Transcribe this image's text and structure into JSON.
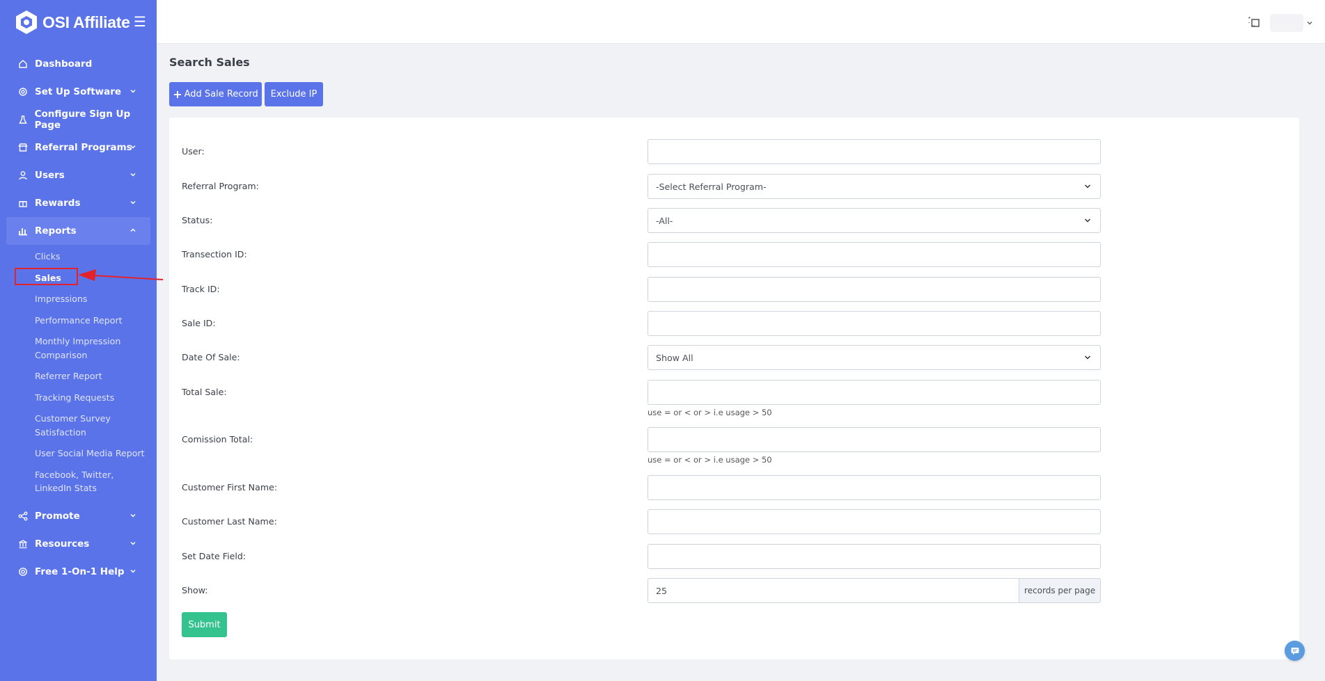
{
  "brand": {
    "name": "OSI Affiliate"
  },
  "sidebar": {
    "items": [
      {
        "label": "Dashboard",
        "icon": "home-icon",
        "has_chevron": false
      },
      {
        "label": "Set Up Software",
        "icon": "gear-icon",
        "has_chevron": true
      },
      {
        "label": "Configure Sign Up Page",
        "icon": "flask-icon",
        "has_chevron": false
      },
      {
        "label": "Referral Programs",
        "icon": "store-icon",
        "has_chevron": true
      },
      {
        "label": "Users",
        "icon": "user-icon",
        "has_chevron": true
      },
      {
        "label": "Rewards",
        "icon": "gift-icon",
        "has_chevron": true
      },
      {
        "label": "Reports",
        "icon": "bar-chart-icon",
        "has_chevron": true,
        "active": true
      }
    ],
    "reports_submenu": [
      "Clicks",
      "Sales",
      "Impressions",
      "Performance Report",
      "Monthly Impression Comparison",
      "Referrer Report",
      "Tracking Requests",
      "Customer Survey Satisfaction",
      "User Social Media Report",
      "Facebook, Twitter, LinkedIn Stats"
    ],
    "current_submenu": "Sales",
    "bottom_items": [
      {
        "label": "Promote",
        "icon": "share-icon",
        "has_chevron": true
      },
      {
        "label": "Resources",
        "icon": "bank-icon",
        "has_chevron": true
      },
      {
        "label": "Free 1-On-1 Help",
        "icon": "lifebuoy-icon",
        "has_chevron": true
      }
    ]
  },
  "page": {
    "title": "Search Sales",
    "add_button": "Add Sale Record",
    "exclude_button": "Exclude IP"
  },
  "form": {
    "fields": [
      {
        "label": "User:",
        "type": "text",
        "value": ""
      },
      {
        "label": "Referral Program:",
        "type": "select",
        "value": "-Select Referral Program-"
      },
      {
        "label": "Status:",
        "type": "select",
        "value": "-All-"
      },
      {
        "label": "Transection ID:",
        "type": "text",
        "value": ""
      },
      {
        "label": "Track ID:",
        "type": "text",
        "value": ""
      },
      {
        "label": "Sale ID:",
        "type": "text",
        "value": ""
      },
      {
        "label": "Date Of Sale:",
        "type": "select",
        "value": "Show All"
      },
      {
        "label": "Total Sale:",
        "type": "text",
        "value": "",
        "hint": "use = or < or > i.e usage > 50"
      },
      {
        "label": "Comission Total:",
        "type": "text",
        "value": "",
        "hint": "use = or < or > i.e usage > 50"
      },
      {
        "label": "Customer First Name:",
        "type": "text",
        "value": ""
      },
      {
        "label": "Customer Last Name:",
        "type": "text",
        "value": ""
      },
      {
        "label": "Set Date Field:",
        "type": "text",
        "value": ""
      }
    ],
    "show": {
      "label": "Show:",
      "value": "25",
      "addon": "records per page"
    },
    "submit": "Submit"
  },
  "colors": {
    "sidebar": "#5b73e8",
    "primary": "#5b73e8",
    "success": "#34c38f",
    "highlight": "#e3232b"
  }
}
